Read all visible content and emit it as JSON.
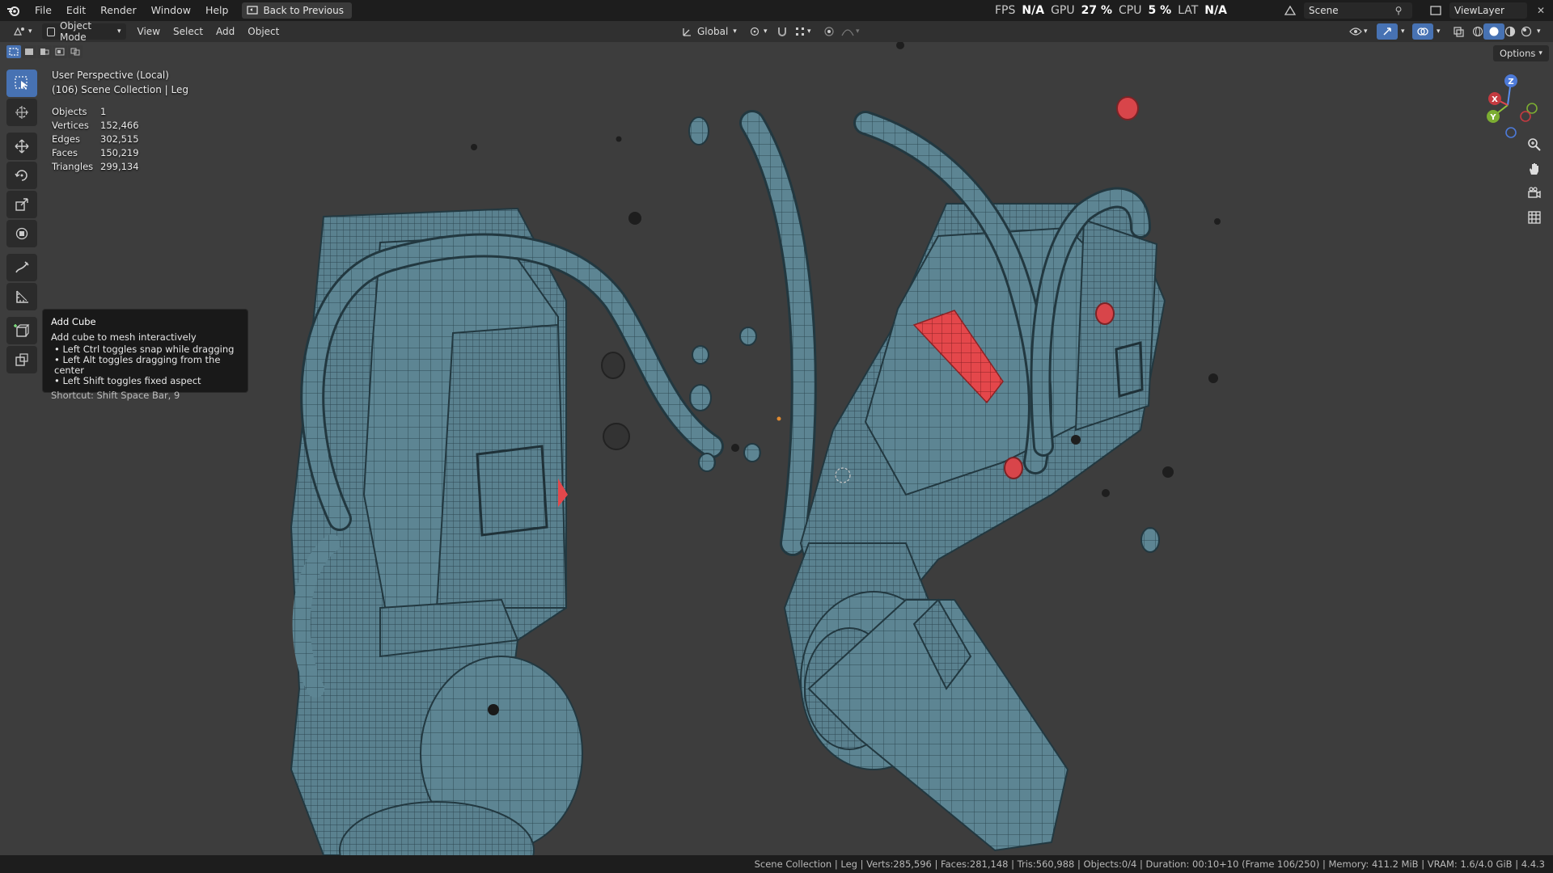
{
  "menu": {
    "file": "File",
    "edit": "Edit",
    "render": "Render",
    "window": "Window",
    "help": "Help",
    "back_button": "Back to Previous"
  },
  "perf": {
    "fps_label": "FPS",
    "fps_value": "N/A",
    "gpu_label": "GPU",
    "gpu_value": "27 %",
    "cpu_label": "CPU",
    "cpu_value": "5 %",
    "lat_label": "LAT",
    "lat_value": "N/A"
  },
  "scene": {
    "name": "Scene"
  },
  "view_layer": {
    "name": "ViewLayer"
  },
  "viewport_header": {
    "mode": "Object Mode",
    "view": "View",
    "select": "Select",
    "add": "Add",
    "object": "Object",
    "orientation": "Global",
    "options": "Options"
  },
  "overlay": {
    "perspective": "User Perspective (Local)",
    "collection": "(106) Scene Collection | Leg",
    "stats": [
      {
        "label": "Objects",
        "value": "1"
      },
      {
        "label": "Vertices",
        "value": "152,466"
      },
      {
        "label": "Edges",
        "value": "302,515"
      },
      {
        "label": "Faces",
        "value": "150,219"
      },
      {
        "label": "Triangles",
        "value": "299,134"
      }
    ]
  },
  "tooltip": {
    "title": "Add Cube",
    "description": "Add cube to mesh interactively",
    "bullets": [
      "• Left Ctrl toggles snap while dragging",
      "• Left Alt toggles dragging from the center",
      "• Left Shift toggles fixed aspect"
    ],
    "shortcut": "Shortcut: Shift Space Bar, 9"
  },
  "gizmo": {
    "x": "X",
    "y": "Y",
    "z": "Z"
  },
  "statusbar": {
    "text": "Scene Collection | Leg | Verts:285,596 | Faces:281,148 | Tris:560,988 | Objects:0/4 | Duration: 00:10+10 (Frame 106/250) | Memory: 411.2 MiB | VRAM: 1.6/4.0 GiB | 4.4.3"
  },
  "colors": {
    "accent": "#4772b3",
    "mesh": "#5e8593",
    "selected_faces": "#e8474a",
    "viewport_bg": "#3d3d3d"
  }
}
